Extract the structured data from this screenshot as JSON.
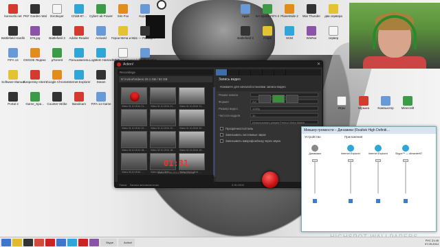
{
  "desktop": {
    "icons": [
      {
        "label": "kunsozbi.net",
        "color": "r"
      },
      {
        "label": "PKF Garden Walker",
        "color": "k"
      },
      {
        "label": "Ext.Buyer",
        "color": "w"
      },
      {
        "label": "Ct'ddt-87…",
        "color": "c"
      },
      {
        "label": "Cyber! ab PowerDV…",
        "color": "gr"
      },
      {
        "label": "Sim Fox",
        "color": "o"
      },
      {
        "label": "Корзина",
        "color": "g"
      },
      {
        "label": "Battlefield Hardline Beta",
        "color": "k"
      },
      {
        "label": "576.jpg",
        "color": "p"
      },
      {
        "label": "Battlefield 3",
        "color": "k"
      },
      {
        "label": "Adobe Reader",
        "color": "r"
      },
      {
        "label": "Activold",
        "color": "g"
      },
      {
        "label": "Герои Меча и Магии",
        "color": "y"
      },
      {
        "label": "11 — Разбор…",
        "color": "k"
      },
      {
        "label": "FIFA 14",
        "color": "g"
      },
      {
        "label": "OSGOE Яндекс Ru.vps",
        "color": "o"
      },
      {
        "label": "µTorrent",
        "color": "gr"
      },
      {
        "label": "Пользователь",
        "color": "c"
      },
      {
        "label": "LogMeIn Hamachi",
        "color": "c"
      },
      {
        "label": "WMF-13 Меню",
        "color": "w"
      },
      {
        "label": "Adobe Photoshop",
        "color": "g"
      },
      {
        "label": "Software Manual",
        "color": "y"
      },
      {
        "label": "Kaspersky Internet Sec.",
        "color": "r"
      },
      {
        "label": "Google Chrome",
        "color": "o"
      },
      {
        "label": "Internet Explorer",
        "color": "c"
      },
      {
        "label": "Steam",
        "color": "k"
      },
      {
        "label": "Audacity",
        "color": "o"
      },
      {
        "label": "Skype",
        "color": "c"
      },
      {
        "label": "Portal 2",
        "color": "k"
      },
      {
        "label": "Game_Spa…",
        "color": "gr"
      },
      {
        "label": "Counter-Strike",
        "color": "k"
      },
      {
        "label": "Bandicam",
        "color": "r"
      },
      {
        "label": "FIFA 14 Game",
        "color": "g"
      },
      {
        "label": "Portal",
        "color": "k"
      },
      {
        "label": "Pic_9781.jpg",
        "color": "p"
      },
      {
        "label": "Apps",
        "color": "g"
      },
      {
        "label": "EA Sports FIFA World",
        "color": "gr"
      },
      {
        "label": "PlanetSide 2",
        "color": "o"
      },
      {
        "label": "War Thunder",
        "color": "k"
      },
      {
        "label": "два сервера",
        "color": "y"
      },
      {
        "label": "Battlefield 3",
        "color": "k"
      },
      {
        "label": "Fraps",
        "color": "y"
      },
      {
        "label": "SCM",
        "color": "c"
      },
      {
        "label": "WinRar",
        "color": "p"
      },
      {
        "label": "сервер",
        "color": "w"
      },
      {
        "label": "Игры",
        "color": "w"
      },
      {
        "label": "Музыка",
        "color": "r"
      },
      {
        "label": "Компьютер",
        "color": "g"
      },
      {
        "label": "Minecraft",
        "color": "gr"
      }
    ]
  },
  "recorder": {
    "title": "Action!",
    "left_top": "Recordings",
    "path": "D:\\Action\\Videos  20.1 GB / 92 GB",
    "thumbs": [
      "Video 01.10.2014 21-…",
      "Video 01.10.2014 21-…",
      "Video 01.10.2014 21-…",
      "Video 01.10.2014 22-…",
      "Video 01.10.2014 22-…",
      "Video 01.10.2014 22-…",
      "Video 02.10.2014 18-…",
      "Video 02.10.2014 18-…",
      "Video 02.10.2014 19-…",
      "Video 03.10.2014 …",
      "Video 03.10.2014 …",
      "Video 03.10.2014 …"
    ],
    "timer": "01:31",
    "timer_sub": "Video 07.09.2014 21-34-26.avi",
    "tab_active_label": "Запись видео",
    "section_desc": "Нажмите для начала/остановки записи видео",
    "rows": [
      {
        "key": "Режим записи",
        "value": ""
      },
      {
        "key": "Формат",
        "value": "AVI"
      },
      {
        "key": "Размер видео",
        "value": "1280p"
      },
      {
        "key": "Частота кадров",
        "value": "30"
      },
      {
        "key": "",
        "value": "Использовать режим Perfect Video Match"
      }
    ],
    "checks": [
      "Прозрачность/стиль",
      "Записывать системные звуки",
      "Записывать микрофон/вход через звука"
    ],
    "footer_left": "Папка",
    "footer_right": "Записи автоматически",
    "status_time": "3.90.2000"
  },
  "mixer": {
    "title": "Микшер громкости – Динамики (Realtek High Definiti…",
    "section_device": "Устройство",
    "section_apps": "Приложения",
    "columns": [
      {
        "name": "Динамики",
        "color": "#888"
      },
      {
        "name": "Internet Explorer",
        "color": "#2ea6d8"
      },
      {
        "name": "Internet Explorer",
        "color": "#2ea6d8"
      },
      {
        "name": "Skype™ — dimanter97",
        "color": "#2ea6d8"
      }
    ]
  },
  "taskbar": {
    "items": [
      "Проводник",
      "Steam",
      "Chrome",
      "Opera",
      "Explorer",
      "Skype",
      "Action",
      "Музыка",
      "Skype",
      "Action!"
    ],
    "lang": "РУС",
    "time": "21:45",
    "date": "07.09.2014"
  },
  "watermark": "HIGHSPOT WALLPAPERS"
}
